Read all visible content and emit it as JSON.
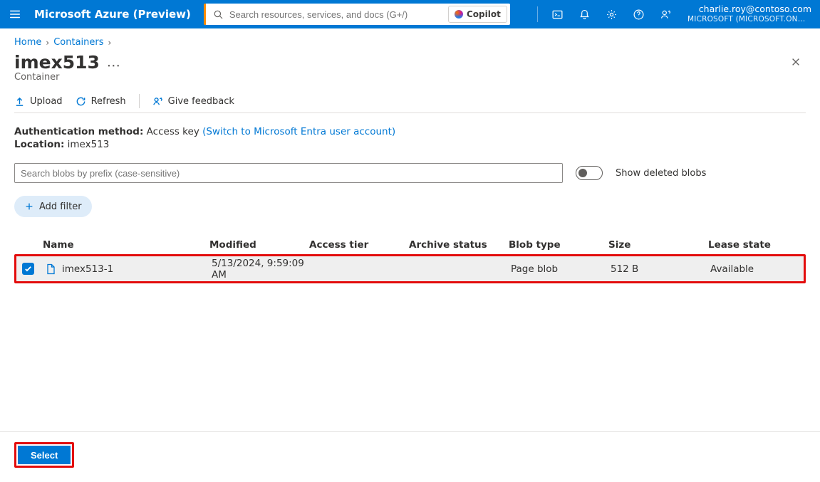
{
  "brand": "Microsoft Azure (Preview)",
  "search": {
    "placeholder": "Search resources, services, and docs (G+/)"
  },
  "copilot": {
    "label": "Copilot"
  },
  "account": {
    "email": "charlie.roy@contoso.com",
    "tenant": "MICROSOFT (MICROSOFT.ONMI…"
  },
  "breadcrumb": {
    "home": "Home",
    "containers": "Containers"
  },
  "title": "imex513",
  "subtitle": "Container",
  "toolbar": {
    "upload": "Upload",
    "refresh": "Refresh",
    "give_feedback": "Give feedback"
  },
  "meta": {
    "auth_label": "Authentication method:",
    "auth_value": "Access key",
    "auth_link": "(Switch to Microsoft Entra user account)",
    "location_label": "Location:",
    "location_value": "imex513"
  },
  "blob_search": {
    "placeholder": "Search blobs by prefix (case-sensitive)"
  },
  "toggle": {
    "label": "Show deleted blobs"
  },
  "filter": {
    "label": "Add filter"
  },
  "columns": {
    "name": "Name",
    "modified": "Modified",
    "access_tier": "Access tier",
    "archive_status": "Archive status",
    "blob_type": "Blob type",
    "size": "Size",
    "lease_state": "Lease state"
  },
  "rows": [
    {
      "name": "imex513-1",
      "modified": "5/13/2024, 9:59:09 AM",
      "access_tier": "",
      "archive_status": "",
      "blob_type": "Page blob",
      "size": "512 B",
      "lease_state": "Available"
    }
  ],
  "footer": {
    "select": "Select"
  }
}
